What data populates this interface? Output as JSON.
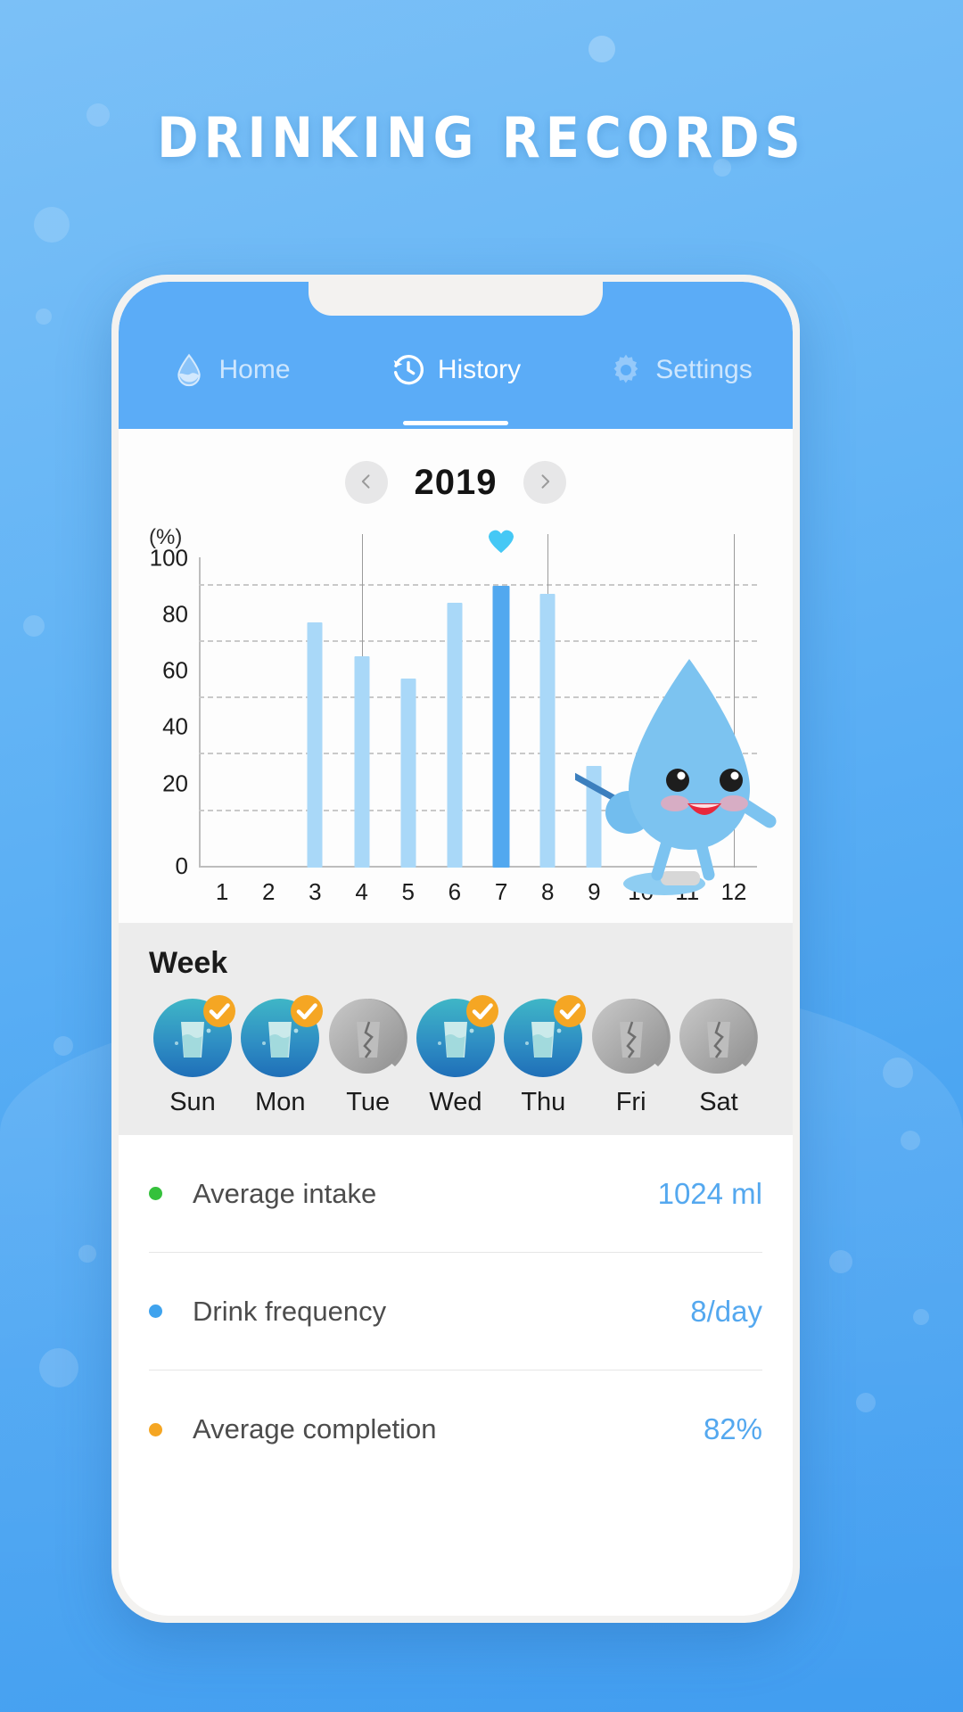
{
  "page": {
    "title": "DRINKING  RECORDS"
  },
  "tabs": [
    {
      "label": "Home",
      "icon": "water-drop-icon",
      "active": false
    },
    {
      "label": "History",
      "icon": "history-clock-icon",
      "active": true
    },
    {
      "label": "Settings",
      "icon": "gear-icon",
      "active": false
    }
  ],
  "year_selector": {
    "year": "2019",
    "prev_icon": "chevron-left-icon",
    "next_icon": "chevron-right-icon"
  },
  "chart_data": {
    "type": "bar",
    "title": "",
    "xlabel": "",
    "ylabel": "(%)",
    "unit_label": "(%)",
    "categories": [
      "1",
      "2",
      "3",
      "4",
      "5",
      "6",
      "7",
      "8",
      "9",
      "10",
      "11",
      "12"
    ],
    "values": [
      0,
      0,
      87,
      75,
      67,
      94,
      100,
      97,
      36,
      0,
      0,
      0
    ],
    "highlight_index": 6,
    "highlight_marker": "heart-icon",
    "ylim": [
      0,
      110
    ],
    "yticks": [
      0,
      20,
      40,
      60,
      80,
      100
    ],
    "ytick_labels": [
      "0",
      "20",
      "40",
      "60",
      "80",
      "100"
    ],
    "grid": true,
    "gridlines_at": [
      20,
      40,
      60,
      80,
      100
    ],
    "vertical_markers": [
      3,
      7,
      11
    ],
    "legend": "none",
    "bar_color": "#a9d8f8",
    "highlight_color": "#52a8ef",
    "mascot": "water-drop-mascot-icon"
  },
  "week": {
    "title": "Week",
    "days": [
      {
        "label": "Sun",
        "completed": true,
        "icon": "full-glass-icon",
        "badge": "check-badge-icon"
      },
      {
        "label": "Mon",
        "completed": true,
        "icon": "full-glass-icon",
        "badge": "check-badge-icon"
      },
      {
        "label": "Tue",
        "completed": false,
        "icon": "broken-glass-icon",
        "badge": ""
      },
      {
        "label": "Wed",
        "completed": true,
        "icon": "full-glass-icon",
        "badge": "check-badge-icon"
      },
      {
        "label": "Thu",
        "completed": true,
        "icon": "full-glass-icon",
        "badge": "check-badge-icon"
      },
      {
        "label": "Fri",
        "completed": false,
        "icon": "broken-glass-icon",
        "badge": ""
      },
      {
        "label": "Sat",
        "completed": false,
        "icon": "broken-glass-icon",
        "badge": ""
      }
    ]
  },
  "stats": [
    {
      "label": "Average intake",
      "value": "1024 ml",
      "dot_color": "#35c13c"
    },
    {
      "label": "Drink frequency",
      "value": "8/day",
      "dot_color": "#3fa3ee"
    },
    {
      "label": "Average completion",
      "value": "82%",
      "dot_color": "#f5a623"
    }
  ],
  "colors": {
    "background_top": "#7bc0f7",
    "background_bottom": "#3d9bf0",
    "tabbar": "#5bacf7",
    "accent": "#54a8ef",
    "badge": "#f5a623"
  }
}
